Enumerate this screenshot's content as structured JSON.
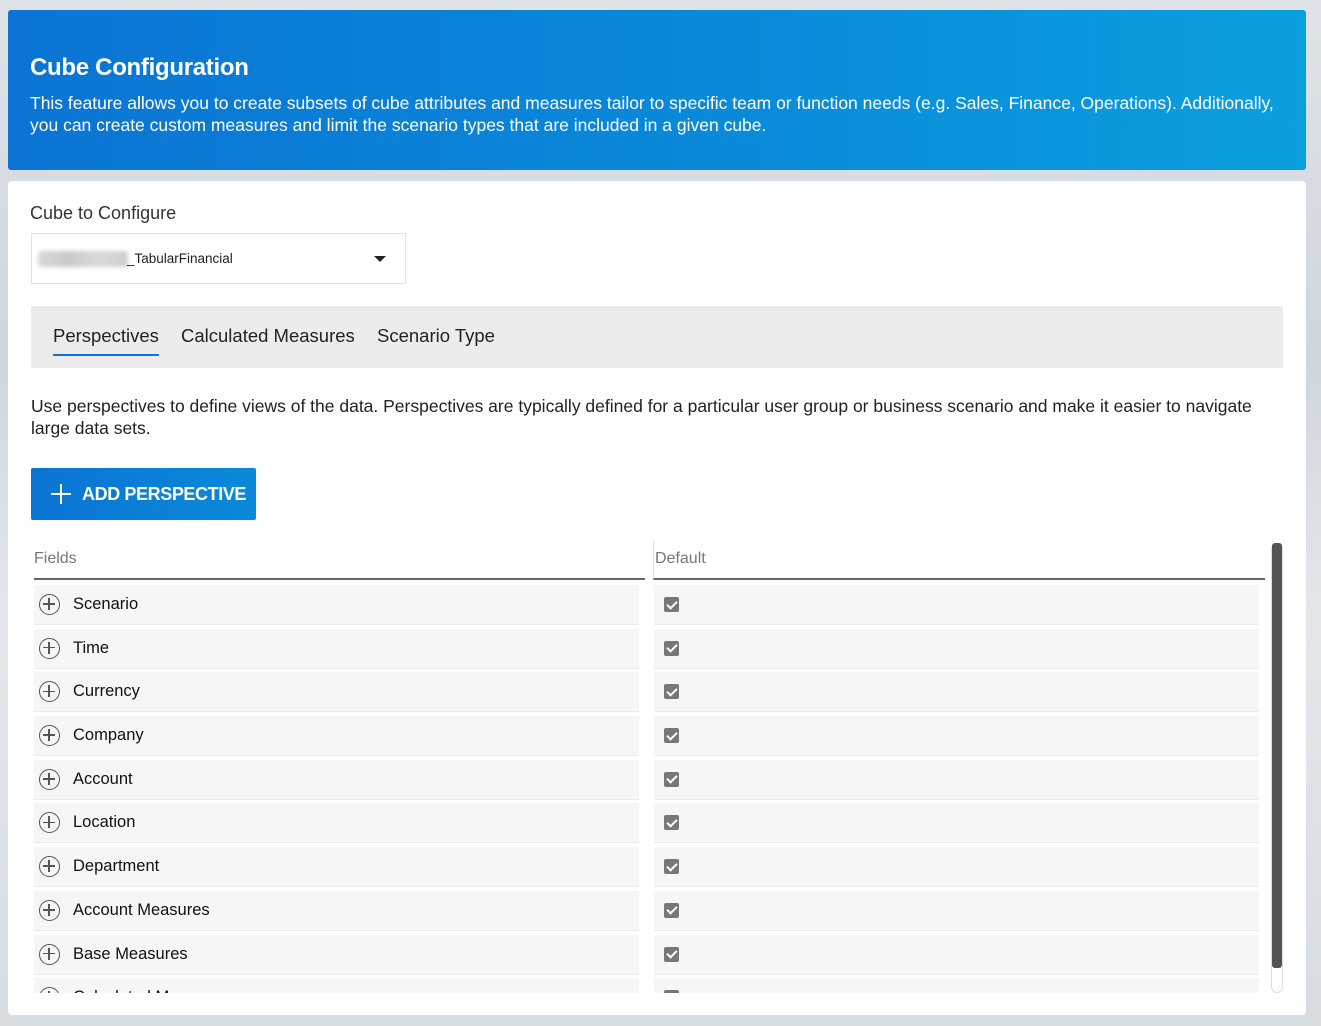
{
  "header": {
    "title": "Cube Configuration",
    "description": "This feature allows you to create subsets of cube attributes and measures tailor to specific team or function needs (e.g. Sales, Finance, Operations). Additionally, you can create custom measures and limit the scenario types that are included in a given cube."
  },
  "cube": {
    "label": "Cube to Configure",
    "selected_value": "_TabularFinancial"
  },
  "tabs": [
    {
      "label": "Perspectives",
      "active": true
    },
    {
      "label": "Calculated Measures",
      "active": false
    },
    {
      "label": "Scenario Type",
      "active": false
    }
  ],
  "perspectives": {
    "description": "Use perspectives to define views of the data. Perspectives are typically defined for a particular user group or business scenario and make it easier to navigate large data sets.",
    "add_button_label": "ADD PERSPECTIVE"
  },
  "grid": {
    "columns": [
      "Fields",
      "Default"
    ],
    "rows": [
      {
        "field": "Scenario",
        "default": true
      },
      {
        "field": "Time",
        "default": true
      },
      {
        "field": "Currency",
        "default": true
      },
      {
        "field": "Company",
        "default": true
      },
      {
        "field": "Account",
        "default": true
      },
      {
        "field": "Location",
        "default": true
      },
      {
        "field": "Department",
        "default": true
      },
      {
        "field": "Account Measures",
        "default": true
      },
      {
        "field": "Base Measures",
        "default": true
      },
      {
        "field": "Calculated Measures",
        "default": true
      }
    ]
  },
  "colors": {
    "accent": "#0b74d4",
    "accent_light": "#0b9fdf",
    "checkbox": "#777777"
  },
  "icons": {
    "add": "plus-icon",
    "expand": "plus-circle-icon",
    "dropdown": "caret-down-icon",
    "checked": "checkbox-checked-icon"
  }
}
